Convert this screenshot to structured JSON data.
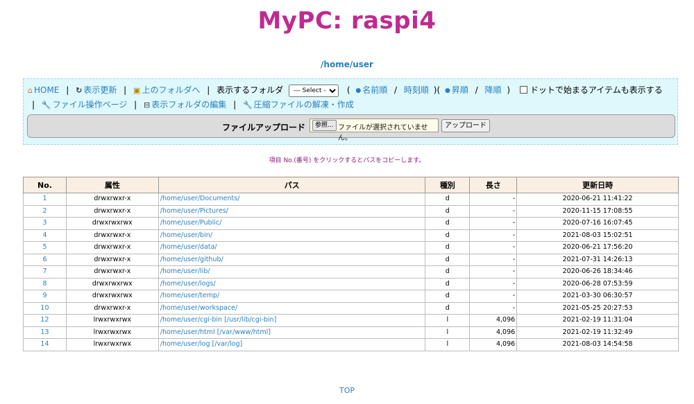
{
  "title": "MyPC: raspi4",
  "current_path": "/home/user",
  "toolbar": {
    "home": "HOME",
    "refresh": "表示更新",
    "parent": "上のフォルダへ",
    "folder_label": "表示するフォルダ",
    "select_value": "--- Select ---",
    "open_paren": "(",
    "sort_name": "名前順",
    "slash": "/",
    "sort_time": "時刻順",
    "mid_paren": ")(",
    "asc": "昇順",
    "desc": "降順",
    "close_paren": ")",
    "show_dot": "ドットで始まるアイテムも表示する",
    "file_ops": "ファイル操作ページ",
    "edit_folders": "表示フォルダの編集",
    "archive": "圧縮ファイルの解凍・作成",
    "sep": "|"
  },
  "upload": {
    "label": "ファイルアップロード",
    "browse": "参照...",
    "no_file": "ファイルが選択されていません。",
    "button": "アップロード"
  },
  "hint": "項目 No.(番号) をクリックするとパスをコピーします。",
  "table": {
    "headers": [
      "No.",
      "属性",
      "パス",
      "種別",
      "長さ",
      "更新日時"
    ],
    "rows": [
      {
        "no": "1",
        "attr": "drwxrwxr-x",
        "path": "/home/user/Documents/",
        "type": "d",
        "size": "-",
        "date": "2020-06-21 11:41:22"
      },
      {
        "no": "2",
        "attr": "drwxrwxr-x",
        "path": "/home/user/Pictures/",
        "type": "d",
        "size": "-",
        "date": "2020-11-15 17:08:55"
      },
      {
        "no": "3",
        "attr": "drwxrwxrwx",
        "path": "/home/user/Public/",
        "type": "d",
        "size": "-",
        "date": "2020-07-16 16:07:45"
      },
      {
        "no": "4",
        "attr": "drwxrwxr-x",
        "path": "/home/user/bin/",
        "type": "d",
        "size": "-",
        "date": "2021-08-03 15:02:51"
      },
      {
        "no": "5",
        "attr": "drwxrwxr-x",
        "path": "/home/user/data/",
        "type": "d",
        "size": "-",
        "date": "2020-06-21 17:56:20"
      },
      {
        "no": "6",
        "attr": "drwxrwxr-x",
        "path": "/home/user/github/",
        "type": "d",
        "size": "-",
        "date": "2021-07-31 14:26:13"
      },
      {
        "no": "7",
        "attr": "drwxrwxr-x",
        "path": "/home/user/lib/",
        "type": "d",
        "size": "-",
        "date": "2020-06-26 18:34:46"
      },
      {
        "no": "8",
        "attr": "drwxrwxrwx",
        "path": "/home/user/logs/",
        "type": "d",
        "size": "-",
        "date": "2020-06-28 07:53:59"
      },
      {
        "no": "9",
        "attr": "drwxrwxrwx",
        "path": "/home/user/temp/",
        "type": "d",
        "size": "-",
        "date": "2021-03-30 06:30:57"
      },
      {
        "no": "10",
        "attr": "drwxrwxr-x",
        "path": "/home/user/workspace/",
        "type": "d",
        "size": "-",
        "date": "2021-05-25 20:27:53"
      },
      {
        "no": "12",
        "attr": "lrwxrwxrwx",
        "path": "/home/user/cgi-bin [/usr/lib/cgi-bin]",
        "type": "l",
        "size": "4,096",
        "date": "2021-02-19 11:31:04"
      },
      {
        "no": "13",
        "attr": "lrwxrwxrwx",
        "path": "/home/user/html [/var/www/html]",
        "type": "l",
        "size": "4,096",
        "date": "2021-02-19 11:32:49"
      },
      {
        "no": "14",
        "attr": "lrwxrwxrwx",
        "path": "/home/user/log [/var/log]",
        "type": "l",
        "size": "4,096",
        "date": "2021-08-03 14:54:58"
      }
    ]
  },
  "top_link": "TOP",
  "colors": {
    "title": "#c02a8f",
    "link": "#2a7fc0",
    "toolbar_bg": "#dff8fc",
    "header_bg": "#fbeee2",
    "hint": "#8a1a7a"
  }
}
